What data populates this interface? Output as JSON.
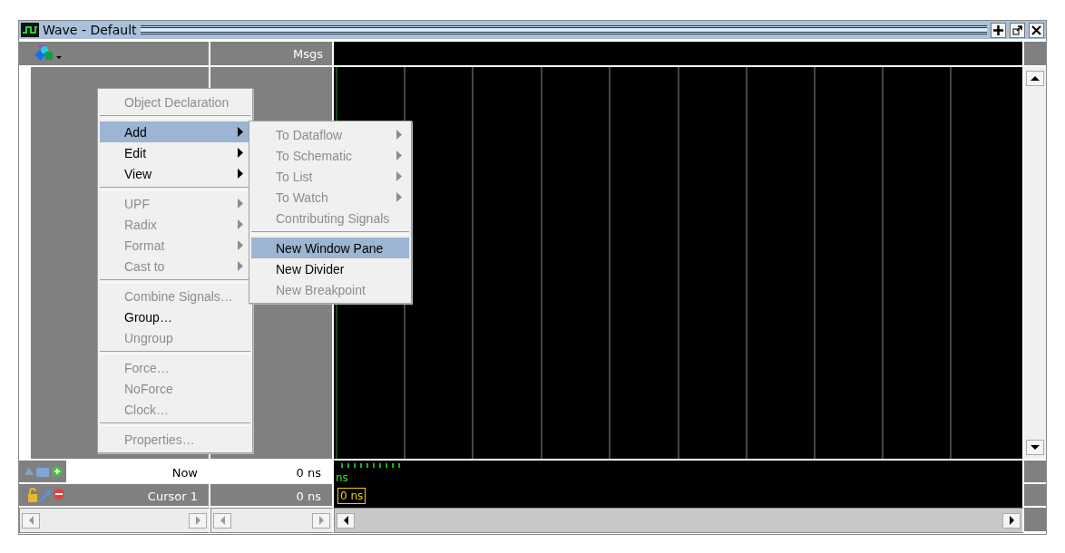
{
  "window": {
    "title": "Wave - Default"
  },
  "header": {
    "value_column": "Msgs"
  },
  "cursors": [
    {
      "label": "Now",
      "value": "0 ns",
      "wave_label": "ns",
      "kind": "now"
    },
    {
      "label": "Cursor 1",
      "value": "0 ns",
      "wave_label": "0 ns",
      "kind": "cursor"
    }
  ],
  "context_menu": {
    "items": [
      {
        "kind": "item",
        "label": "Object Declaration",
        "disabled": true,
        "selected": false,
        "submenu": false
      },
      {
        "kind": "separator"
      },
      {
        "kind": "item",
        "label": "Add",
        "disabled": false,
        "selected": true,
        "submenu": true
      },
      {
        "kind": "item",
        "label": "Edit",
        "disabled": false,
        "selected": false,
        "submenu": true
      },
      {
        "kind": "item",
        "label": "View",
        "disabled": false,
        "selected": false,
        "submenu": true
      },
      {
        "kind": "separator"
      },
      {
        "kind": "item",
        "label": "UPF",
        "disabled": true,
        "selected": false,
        "submenu": true
      },
      {
        "kind": "item",
        "label": "Radix",
        "disabled": true,
        "selected": false,
        "submenu": true
      },
      {
        "kind": "item",
        "label": "Format",
        "disabled": true,
        "selected": false,
        "submenu": true
      },
      {
        "kind": "item",
        "label": "Cast to",
        "disabled": true,
        "selected": false,
        "submenu": true
      },
      {
        "kind": "separator"
      },
      {
        "kind": "item",
        "label": "Combine Signals…",
        "disabled": true,
        "selected": false,
        "submenu": false
      },
      {
        "kind": "item",
        "label": "Group…",
        "disabled": false,
        "selected": false,
        "submenu": false
      },
      {
        "kind": "item",
        "label": "Ungroup",
        "disabled": true,
        "selected": false,
        "submenu": false
      },
      {
        "kind": "separator"
      },
      {
        "kind": "item",
        "label": "Force…",
        "disabled": true,
        "selected": false,
        "submenu": false
      },
      {
        "kind": "item",
        "label": "NoForce",
        "disabled": true,
        "selected": false,
        "submenu": false
      },
      {
        "kind": "item",
        "label": "Clock…",
        "disabled": true,
        "selected": false,
        "submenu": false
      },
      {
        "kind": "separator"
      },
      {
        "kind": "item",
        "label": "Properties…",
        "disabled": true,
        "selected": false,
        "submenu": false
      }
    ]
  },
  "submenu": {
    "items": [
      {
        "kind": "item",
        "label": "To Dataflow",
        "disabled": true,
        "selected": false,
        "submenu": true
      },
      {
        "kind": "item",
        "label": "To Schematic",
        "disabled": true,
        "selected": false,
        "submenu": true
      },
      {
        "kind": "item",
        "label": "To List",
        "disabled": true,
        "selected": false,
        "submenu": true
      },
      {
        "kind": "item",
        "label": "To Watch",
        "disabled": true,
        "selected": false,
        "submenu": true
      },
      {
        "kind": "item",
        "label": "Contributing Signals",
        "disabled": true,
        "selected": false,
        "submenu": false
      },
      {
        "kind": "separator"
      },
      {
        "kind": "item",
        "label": "New Window Pane",
        "disabled": false,
        "selected": true,
        "submenu": false
      },
      {
        "kind": "item",
        "label": "New Divider",
        "disabled": false,
        "selected": false,
        "submenu": false
      },
      {
        "kind": "item",
        "label": "New Breakpoint",
        "disabled": true,
        "selected": false,
        "submenu": false
      }
    ]
  }
}
